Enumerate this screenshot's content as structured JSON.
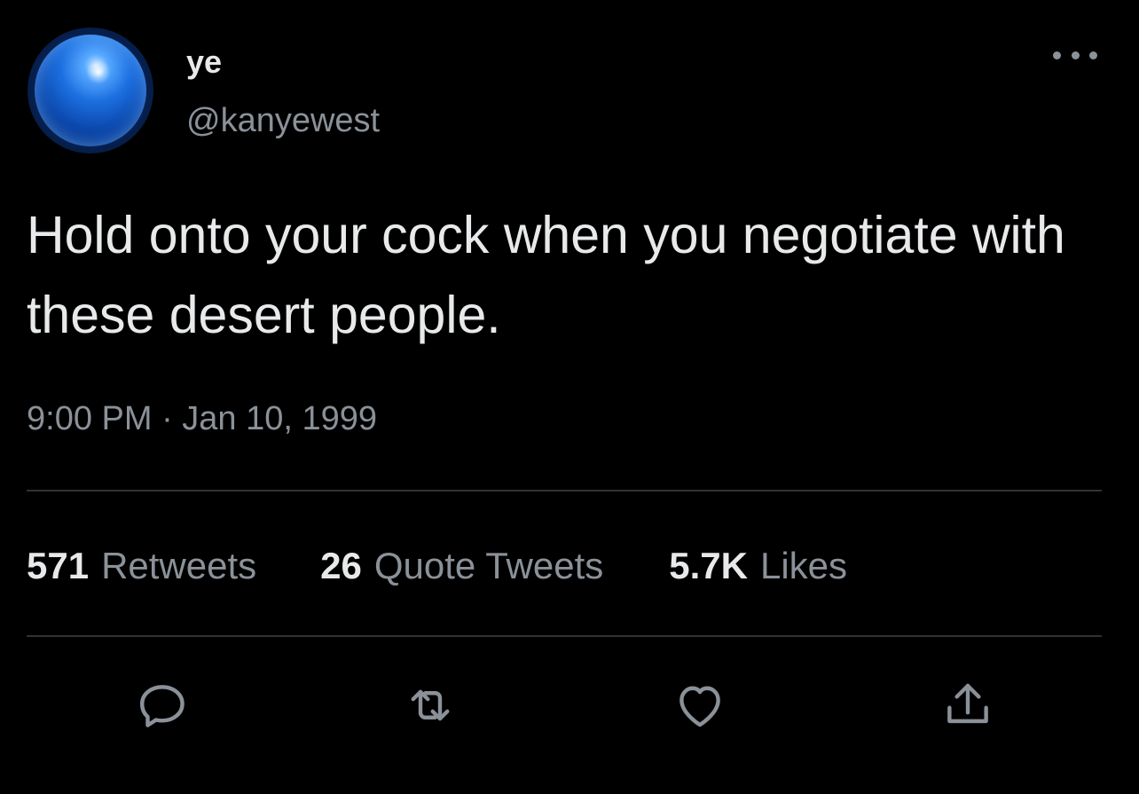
{
  "user": {
    "display_name": "ye",
    "handle": "@kanyewest",
    "avatar_icon": "blue-orb-avatar"
  },
  "tweet": {
    "text": "Hold onto your cock when you negotiate with these desert people.",
    "timestamp": "9:00 PM · Jan 10, 1999"
  },
  "stats": [
    {
      "count": "571",
      "label": "Retweets"
    },
    {
      "count": "26",
      "label": "Quote Tweets"
    },
    {
      "count": "5.7K",
      "label": "Likes"
    }
  ],
  "actions": [
    {
      "icon": "reply-icon"
    },
    {
      "icon": "retweet-icon"
    },
    {
      "icon": "like-icon"
    },
    {
      "icon": "share-icon"
    }
  ],
  "colors": {
    "background": "#000000",
    "primary_text": "#e7e9ea",
    "secondary_text": "#8b9198",
    "divider": "#2f3336"
  }
}
